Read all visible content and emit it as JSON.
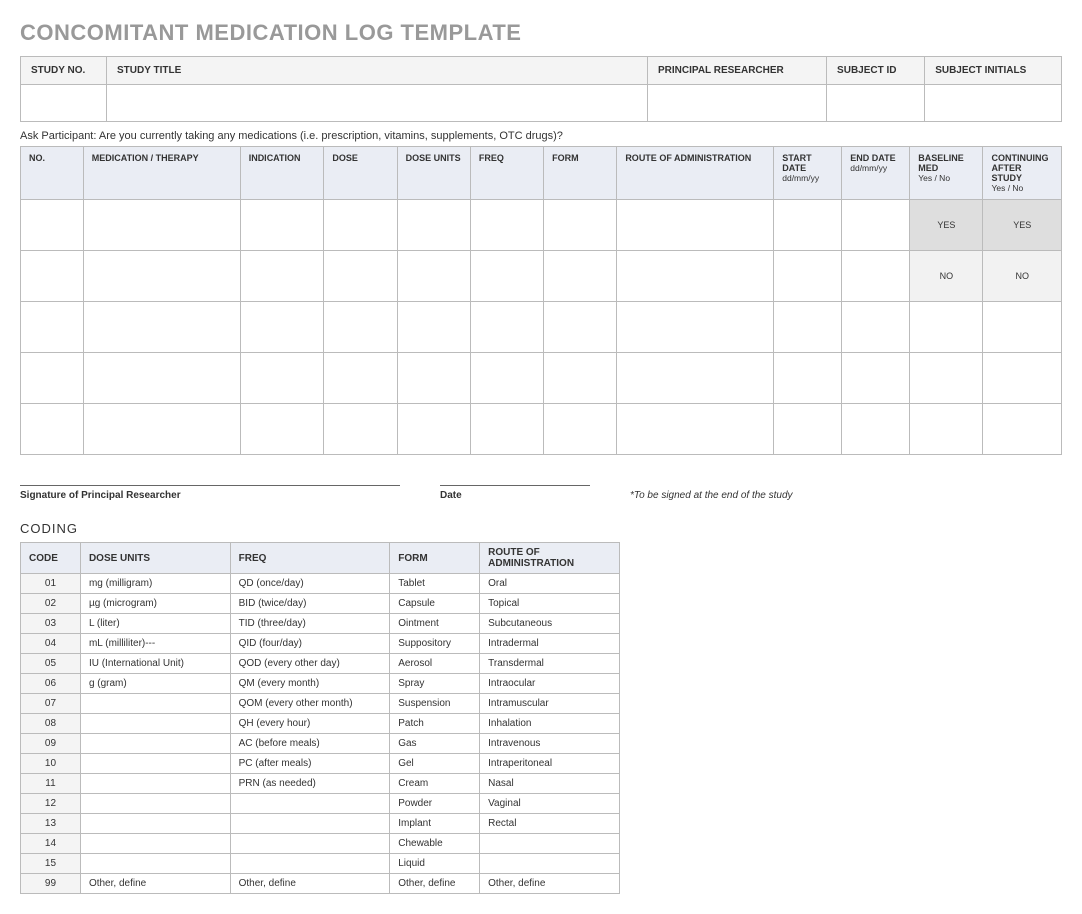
{
  "title": "CONCOMITANT MEDICATION LOG TEMPLATE",
  "info_headers": [
    "STUDY NO.",
    "STUDY TITLE",
    "PRINCIPAL RESEARCHER",
    "SUBJECT ID",
    "SUBJECT INITIALS"
  ],
  "question": "Ask Participant: Are you currently taking any medications (i.e. prescription, vitamins, supplements, OTC drugs)?",
  "main_headers": [
    {
      "label": "NO.",
      "sub": ""
    },
    {
      "label": "MEDICATION / THERAPY",
      "sub": ""
    },
    {
      "label": "INDICATION",
      "sub": ""
    },
    {
      "label": "DOSE",
      "sub": ""
    },
    {
      "label": "DOSE UNITS",
      "sub": ""
    },
    {
      "label": "FREQ",
      "sub": ""
    },
    {
      "label": "FORM",
      "sub": ""
    },
    {
      "label": "ROUTE OF ADMINISTRATION",
      "sub": ""
    },
    {
      "label": "START DATE",
      "sub": "dd/mm/yy"
    },
    {
      "label": "END DATE",
      "sub": "dd/mm/yy"
    },
    {
      "label": "BASELINE MED",
      "sub": "Yes / No"
    },
    {
      "label": "CONTINUING AFTER STUDY",
      "sub": "Yes / No"
    }
  ],
  "main_rows": [
    {
      "baseline": "YES",
      "cont": "YES",
      "shade": true
    },
    {
      "baseline": "NO",
      "cont": "NO",
      "shade": false
    },
    {
      "baseline": "",
      "cont": "",
      "shade": false
    },
    {
      "baseline": "",
      "cont": "",
      "shade": false
    },
    {
      "baseline": "",
      "cont": "",
      "shade": false
    }
  ],
  "sig_label": "Signature of Principal Researcher",
  "date_label": "Date",
  "sig_note": "*To be signed at the end of the study",
  "coding_title": "CODING",
  "coding_headers": [
    "CODE",
    "DOSE UNITS",
    "FREQ",
    "FORM",
    "ROUTE OF ADMINISTRATION"
  ],
  "coding_rows": [
    {
      "code": "01",
      "units": "mg (milligram)",
      "freq": "QD (once/day)",
      "form": "Tablet",
      "route": "Oral"
    },
    {
      "code": "02",
      "units": "µg (microgram)",
      "freq": "BID (twice/day)",
      "form": "Capsule",
      "route": "Topical"
    },
    {
      "code": "03",
      "units": "L (liter)",
      "freq": "TID (three/day)",
      "form": "Ointment",
      "route": "Subcutaneous"
    },
    {
      "code": "04",
      "units": "mL (milliliter)---",
      "freq": "QID (four/day)",
      "form": "Suppository",
      "route": "Intradermal"
    },
    {
      "code": "05",
      "units": "IU (International Unit)",
      "freq": "QOD (every other day)",
      "form": "Aerosol",
      "route": "Transdermal"
    },
    {
      "code": "06",
      "units": "g (gram)",
      "freq": "QM (every month)",
      "form": "Spray",
      "route": "Intraocular"
    },
    {
      "code": "07",
      "units": "",
      "freq": "QOM (every other month)",
      "form": "Suspension",
      "route": "Intramuscular"
    },
    {
      "code": "08",
      "units": "",
      "freq": "QH (every hour)",
      "form": "Patch",
      "route": "Inhalation"
    },
    {
      "code": "09",
      "units": "",
      "freq": "AC (before meals)",
      "form": "Gas",
      "route": "Intravenous"
    },
    {
      "code": "10",
      "units": "",
      "freq": "PC (after meals)",
      "form": "Gel",
      "route": "Intraperitoneal"
    },
    {
      "code": "11",
      "units": "",
      "freq": "PRN (as needed)",
      "form": "Cream",
      "route": "Nasal"
    },
    {
      "code": "12",
      "units": "",
      "freq": "",
      "form": "Powder",
      "route": "Vaginal"
    },
    {
      "code": "13",
      "units": "",
      "freq": "",
      "form": "Implant",
      "route": "Rectal"
    },
    {
      "code": "14",
      "units": "",
      "freq": "",
      "form": "Chewable",
      "route": ""
    },
    {
      "code": "15",
      "units": "",
      "freq": "",
      "form": "Liquid",
      "route": ""
    },
    {
      "code": "99",
      "units": "Other, define",
      "freq": "Other, define",
      "form": "Other, define",
      "route": "Other, define"
    }
  ]
}
